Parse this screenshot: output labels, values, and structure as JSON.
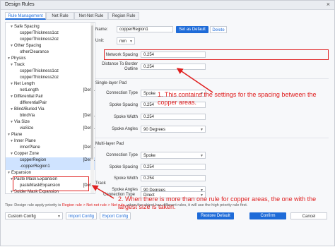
{
  "window": {
    "title": "Design Rules",
    "close_glyph": "×"
  },
  "tabs": [
    {
      "label": "Rule Management"
    },
    {
      "label": "Net Rule"
    },
    {
      "label": "Net-Net Rule"
    },
    {
      "label": "Region Rule"
    }
  ],
  "tree": [
    {
      "label": "Safe Spacing",
      "indent": 1,
      "arrow": "▼"
    },
    {
      "label": "copperThickness1oz",
      "indent": 3,
      "arrow": ""
    },
    {
      "label": "copperThickness2oz",
      "indent": 3,
      "arrow": ""
    },
    {
      "label": "Other Spacing",
      "indent": 1,
      "arrow": "▼"
    },
    {
      "label": "otherClearance",
      "indent": 3,
      "arrow": ""
    },
    {
      "label": "Physics",
      "indent": 0,
      "arrow": "▼"
    },
    {
      "label": "Track",
      "indent": 1,
      "arrow": "▼"
    },
    {
      "label": "copperThickness1oz",
      "indent": 3,
      "arrow": ""
    },
    {
      "label": "copperThickness2oz",
      "indent": 3,
      "arrow": ""
    },
    {
      "label": "Net Length",
      "indent": 1,
      "arrow": "▼"
    },
    {
      "label": "netLength",
      "indent": 3,
      "arrow": "",
      "right": "[Default]"
    },
    {
      "label": "Differential Pair",
      "indent": 1,
      "arrow": "▼"
    },
    {
      "label": "differentialPair",
      "indent": 3,
      "arrow": ""
    },
    {
      "label": "Blind/Buried Via",
      "indent": 1,
      "arrow": "▼"
    },
    {
      "label": "blindVia",
      "indent": 3,
      "arrow": "",
      "right": "[Default]"
    },
    {
      "label": "Via Size",
      "indent": 1,
      "arrow": "▼"
    },
    {
      "label": "viaSize",
      "indent": 3,
      "arrow": "",
      "right": "[Default]"
    },
    {
      "label": "Plane",
      "indent": 0,
      "arrow": "▼"
    },
    {
      "label": "Inner Plane",
      "indent": 1,
      "arrow": "▼"
    },
    {
      "label": "innerPlane",
      "indent": 3,
      "arrow": "",
      "right": "[Default]"
    },
    {
      "label": "Copper Zone",
      "indent": 1,
      "arrow": "▼"
    },
    {
      "label": "copperRegion",
      "indent": 3,
      "arrow": "",
      "right": "[Default]"
    },
    {
      "label": "-copperRegion1",
      "indent": 3,
      "arrow": ""
    },
    {
      "label": "Expansion",
      "indent": 0,
      "arrow": "▼"
    },
    {
      "label": "Paste Mask Expansion",
      "indent": 1,
      "arrow": "▼"
    },
    {
      "label": "pasteMaskExpansion",
      "indent": 3,
      "arrow": "",
      "right": "[Default]"
    },
    {
      "label": "Solder Mask Expansion",
      "indent": 1,
      "arrow": "▼"
    }
  ],
  "form": {
    "name_label": "Name:",
    "name_value": "copperRegion1",
    "set_default": "Set as Default",
    "delete": "Delete",
    "unit_label": "Unit:",
    "unit_value": "mm",
    "network_spacing_label": "Network Spacing",
    "network_spacing_value": "0.254",
    "distance_border_label": "Distance To Border Outline",
    "distance_border_value": "0.254",
    "single_layer_title": "Single-layer Pad",
    "multi_layer_title": "Multi-layer Pad",
    "track_title": "Track",
    "conn_type_label": "Connection Type",
    "spoke_spacing_label": "Spoke Spacing",
    "spoke_width_label": "Spoke Width",
    "spoke_angles_label": "Spoke Angles",
    "single": {
      "conn": "Spoke",
      "spacing": "0.254",
      "width": "0.254",
      "angles": "90 Degrees"
    },
    "multi": {
      "conn": "Spoke",
      "spacing": "0.254",
      "width": "0.254",
      "angles": "90 Degrees"
    },
    "track_conn": "Direct"
  },
  "annotations": {
    "note1": "1. This contains the settings for the spacing between the copper areas.",
    "note2": "2. When there is more than one rule for copper areas, the one with the largest size is taken."
  },
  "footer": {
    "tip_a": "Tips: Design rule apply priority is ",
    "tip_red": "Region rule > Net-net rule > Net rule",
    "tip_b": ", when the object has different rules, it will use the high priority rule first.",
    "config_value": "Custom Config",
    "import": "Import Config",
    "export": "Export Config",
    "restore": "Restore Default",
    "confirm": "Confirm",
    "cancel": "Cancel"
  },
  "colors": {
    "accent": "#1e6bd8",
    "annotation": "#e02020"
  }
}
